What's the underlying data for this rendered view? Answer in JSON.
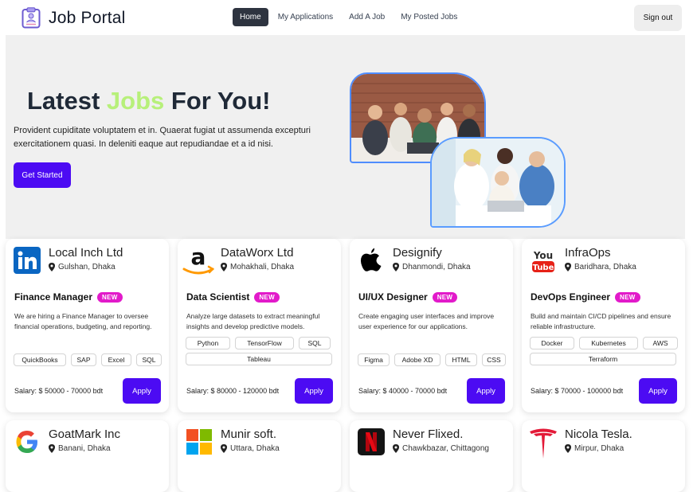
{
  "nav": {
    "brand": "Job Portal",
    "links": [
      "Home",
      "My Applications",
      "Add A Job",
      "My Posted Jobs"
    ],
    "signout": "Sign out"
  },
  "hero": {
    "title_a": "Latest ",
    "title_accent": "Jobs",
    "title_b": " For You!",
    "description": "Provident cupiditate voluptatem et in. Quaerat fugiat ut assumenda excepturi exercitationem quasi. In deleniti eaque aut repudiandae et a id nisi.",
    "cta": "Get Started"
  },
  "colors": {
    "primary": "#4c0bf3",
    "accent": "#b7f07a",
    "badge": "#e21aca",
    "hero_bg": "#f0f0f0"
  },
  "jobs": [
    {
      "company": "Local Inch Ltd",
      "location": "Gulshan, Dhaka",
      "logo": "linkedin-logo",
      "role": "Finance Manager",
      "badge": "NEW",
      "description": "We are hiring a Finance Manager to oversee financial operations, budgeting, and reporting.",
      "tags": [
        "QuickBooks",
        "SAP",
        "Excel",
        "SQL"
      ],
      "salary": "Salary: $ 50000 - 70000 bdt",
      "apply": "Apply"
    },
    {
      "company": "DataWorx Ltd",
      "location": "Mohakhali, Dhaka",
      "logo": "amazon-logo",
      "role": "Data Scientist",
      "badge": "NEW",
      "description": "Analyze large datasets to extract meaningful insights and develop predictive models.",
      "tags": [
        "Python",
        "TensorFlow",
        "SQL",
        "Tableau"
      ],
      "salary": "Salary: $ 80000 - 120000 bdt",
      "apply": "Apply"
    },
    {
      "company": "Designify",
      "location": "Dhanmondi, Dhaka",
      "logo": "apple-logo",
      "role": "UI/UX Designer",
      "badge": "NEW",
      "description": "Create engaging user interfaces and improve user experience for our applications.",
      "tags": [
        "Figma",
        "Adobe XD",
        "HTML",
        "CSS"
      ],
      "salary": "Salary: $ 40000 - 70000 bdt",
      "apply": "Apply"
    },
    {
      "company": "InfraOps",
      "location": "Baridhara, Dhaka",
      "logo": "youtube-logo",
      "role": "DevOps Engineer",
      "badge": "NEW",
      "description": "Build and maintain CI/CD pipelines and ensure reliable infrastructure.",
      "tags": [
        "Docker",
        "Kubernetes",
        "AWS",
        "Terraform"
      ],
      "salary": "Salary: $ 70000 - 100000 bdt",
      "apply": "Apply"
    },
    {
      "company": "GoatMark Inc",
      "location": "Banani, Dhaka",
      "logo": "google-logo"
    },
    {
      "company": "Munir soft.",
      "location": "Uttara, Dhaka",
      "logo": "microsoft-logo"
    },
    {
      "company": "Never Flixed.",
      "location": "Chawkbazar, Chittagong",
      "logo": "netflix-logo"
    },
    {
      "company": "Nicola Tesla.",
      "location": "Mirpur, Dhaka",
      "logo": "tesla-logo"
    }
  ]
}
